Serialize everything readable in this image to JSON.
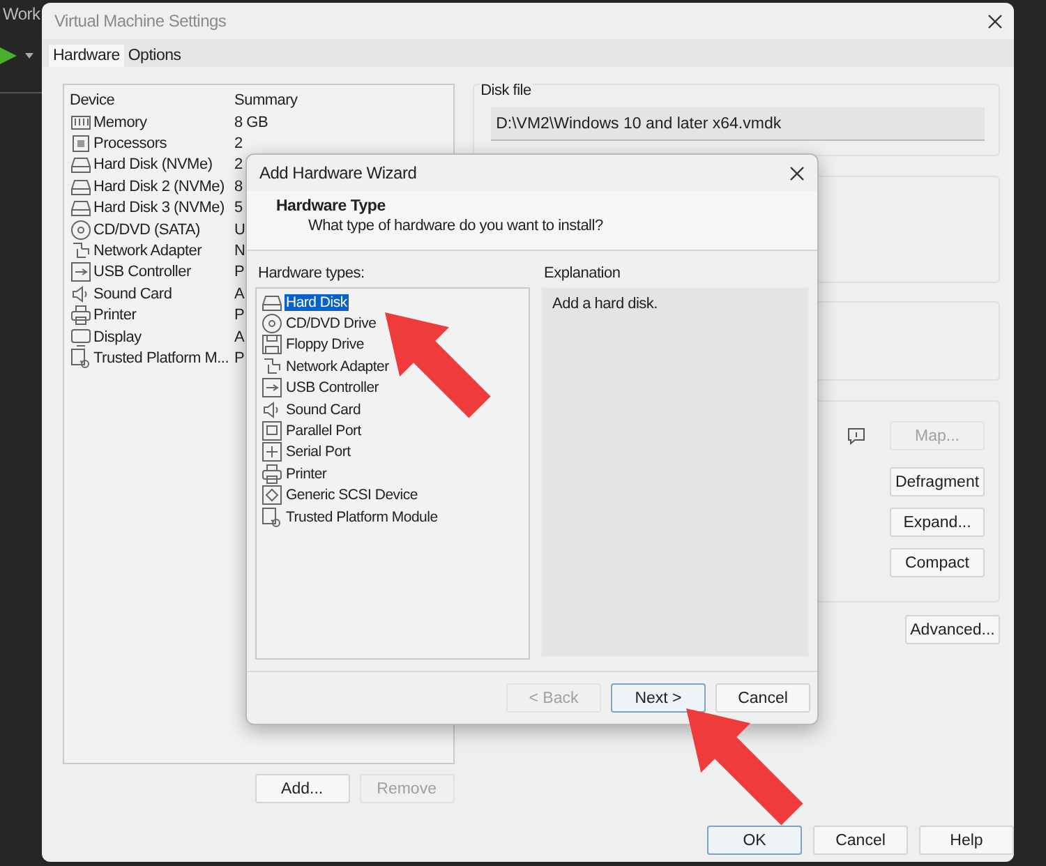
{
  "background_app": {
    "title": "Work"
  },
  "settings_window": {
    "title": "Virtual Machine Settings",
    "tabs": [
      {
        "label": "Hardware",
        "selected": true
      },
      {
        "label": "Options",
        "selected": false
      }
    ],
    "device_table": {
      "columns": [
        "Device",
        "Summary"
      ],
      "rows": [
        {
          "device": "Memory",
          "summary": "8 GB",
          "kind": "memory"
        },
        {
          "device": "Processors",
          "summary": "2",
          "kind": "processor"
        },
        {
          "device": "Hard Disk (NVMe)",
          "summary": "2",
          "kind": "disk"
        },
        {
          "device": "Hard Disk 2 (NVMe)",
          "summary": "8",
          "kind": "disk"
        },
        {
          "device": "Hard Disk 3 (NVMe)",
          "summary": "5",
          "kind": "disk"
        },
        {
          "device": "CD/DVD (SATA)",
          "summary": "U",
          "kind": "cdrom"
        },
        {
          "device": "Network Adapter",
          "summary": "N",
          "kind": "network"
        },
        {
          "device": "USB Controller",
          "summary": "P",
          "kind": "usb"
        },
        {
          "device": "Sound Card",
          "summary": "A",
          "kind": "sound"
        },
        {
          "device": "Printer",
          "summary": "P",
          "kind": "printer"
        },
        {
          "device": "Display",
          "summary": "A",
          "kind": "display"
        },
        {
          "device": "Trusted Platform M...",
          "summary": "P",
          "kind": "tpm"
        }
      ]
    },
    "device_buttons": [
      {
        "label": "Add...",
        "disabled": false
      },
      {
        "label": "Remove",
        "disabled": true
      }
    ],
    "disk_file": {
      "label": "Disk file",
      "value": "D:\\VM2\\Windows 10 and later x64.vmdk"
    },
    "disk_buttons": [
      {
        "label": "Map...",
        "disabled": true
      },
      {
        "label": "Defragment",
        "disabled": false
      },
      {
        "label": "Expand...",
        "disabled": false
      },
      {
        "label": "Compact",
        "disabled": false
      }
    ],
    "advanced_button": {
      "label": "Advanced..."
    },
    "footer_buttons": [
      {
        "label": "OK",
        "default": true
      },
      {
        "label": "Cancel",
        "default": false
      },
      {
        "label": "Help",
        "default": false
      }
    ]
  },
  "wizard": {
    "title": "Add Hardware Wizard",
    "heading": "Hardware Type",
    "subheading": "What type of hardware do you want to install?",
    "types_label": "Hardware types:",
    "types": [
      {
        "label": "Hard Disk",
        "kind": "disk",
        "selected": true
      },
      {
        "label": "CD/DVD Drive",
        "kind": "cdrom",
        "selected": false
      },
      {
        "label": "Floppy Drive",
        "kind": "floppy",
        "selected": false
      },
      {
        "label": "Network Adapter",
        "kind": "network",
        "selected": false
      },
      {
        "label": "USB Controller",
        "kind": "usb",
        "selected": false
      },
      {
        "label": "Sound Card",
        "kind": "sound",
        "selected": false
      },
      {
        "label": "Parallel Port",
        "kind": "parallel",
        "selected": false
      },
      {
        "label": "Serial Port",
        "kind": "serial",
        "selected": false
      },
      {
        "label": "Printer",
        "kind": "printer",
        "selected": false
      },
      {
        "label": "Generic SCSI Device",
        "kind": "scsi",
        "selected": false
      },
      {
        "label": "Trusted Platform Module",
        "kind": "tpm",
        "selected": false
      }
    ],
    "explanation_label": "Explanation",
    "explanation": "Add a hard disk.",
    "buttons": [
      {
        "label": "< Back",
        "disabled": true,
        "default": false
      },
      {
        "label": "Next >",
        "disabled": false,
        "default": true
      },
      {
        "label": "Cancel",
        "disabled": false,
        "default": false
      }
    ]
  }
}
